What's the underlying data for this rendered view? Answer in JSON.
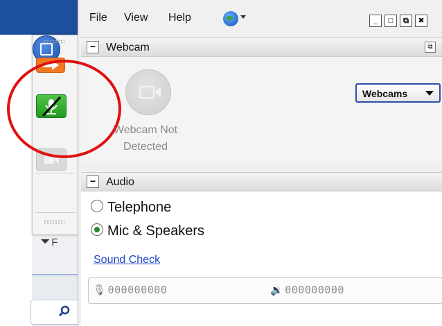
{
  "menu": {
    "file": "File",
    "view": "View",
    "help": "Help"
  },
  "window_buttons": {
    "minimize": "_",
    "maximize": "□",
    "restore": "⧉",
    "close": "✖"
  },
  "webcam": {
    "title": "Webcam",
    "collapse": "−",
    "status_line1": "Webcam Not",
    "status_line2": "Detected",
    "webcams_button": "Webcams"
  },
  "audio": {
    "title": "Audio",
    "collapse": "−",
    "option_telephone": "Telephone",
    "option_mic": "Mic & Speakers",
    "selected": "Mic & Speakers",
    "sound_check": "Sound Check",
    "mic_meter": "000000000",
    "speaker_meter": "000000000"
  },
  "background": {
    "filter_text": "F"
  },
  "colors": {
    "accent_blue": "#2e4ea8",
    "mic_green": "#239a22",
    "annotation_red": "#e01010",
    "toolbar_orange": "#f07820"
  }
}
